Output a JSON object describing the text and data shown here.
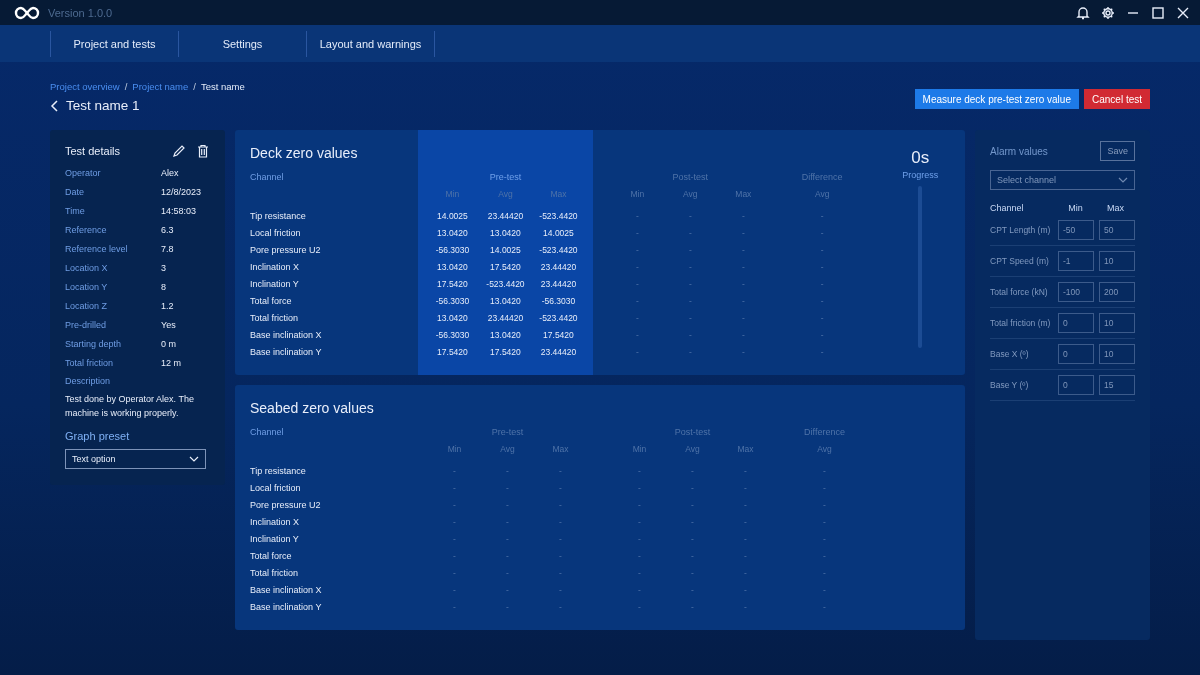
{
  "titlebar": {
    "version": "Version 1.0.0"
  },
  "nav": [
    {
      "label": "Project and tests"
    },
    {
      "label": "Settings"
    },
    {
      "label": "Layout and warnings"
    }
  ],
  "breadcrumb_separator": "/",
  "breadcrumb": [
    {
      "label": "Project overview",
      "link": true
    },
    {
      "label": "Project name",
      "link": true
    },
    {
      "label": "Test name",
      "link": false
    }
  ],
  "page_title": "Test name 1",
  "actions": [
    {
      "label": "Measure deck pre-test zero value",
      "kind": "primary"
    },
    {
      "label": "Cancel test",
      "kind": "danger"
    }
  ],
  "details": {
    "title": "Test details",
    "fields": [
      {
        "label": "Operator",
        "value": "Alex"
      },
      {
        "label": "Date",
        "value": "12/8/2023"
      },
      {
        "label": "Time",
        "value": "14:58:03"
      },
      {
        "label": "Reference",
        "value": "6.3"
      },
      {
        "label": "Reference level",
        "value": "7.8"
      },
      {
        "label": "Location X",
        "value": "3"
      },
      {
        "label": "Location Y",
        "value": "8"
      },
      {
        "label": "Location Z",
        "value": "1.2"
      },
      {
        "label": "Pre-drilled",
        "value": "Yes"
      },
      {
        "label": "Starting depth",
        "value": "0 m"
      },
      {
        "label": "Total friction",
        "value": "12 m"
      }
    ],
    "description_label": "Description",
    "description": "Test done by Operator Alex. The machine is working properly.",
    "preset_label": "Graph preset",
    "preset_value": "Text option"
  },
  "tables": [
    {
      "title": "Deck zero values",
      "channel_header": "Channel",
      "groups": [
        {
          "label": "Pre-test",
          "selected": true,
          "columns": [
            "Min",
            "Avg",
            "Max"
          ]
        },
        {
          "label": "Post-test",
          "selected": false,
          "columns": [
            "Min",
            "Avg",
            "Max"
          ]
        },
        {
          "label": "Difference",
          "selected": false,
          "columns": [
            "Avg"
          ]
        }
      ],
      "progress": {
        "time": "0s",
        "label": "Progress",
        "level": 0
      },
      "rows": [
        {
          "channel": "Tip resistance",
          "values": [
            "14.0025",
            "23.44420",
            "-523.4420",
            "-",
            "-",
            "-",
            "-"
          ]
        },
        {
          "channel": "Local friction",
          "values": [
            "13.0420",
            "13.0420",
            "14.0025",
            "-",
            "-",
            "-",
            "-"
          ]
        },
        {
          "channel": "Pore pressure U2",
          "values": [
            "-56.3030",
            "14.0025",
            "-523.4420",
            "-",
            "-",
            "-",
            "-"
          ]
        },
        {
          "channel": "Inclination X",
          "values": [
            "13.0420",
            "17.5420",
            "23.44420",
            "-",
            "-",
            "-",
            "-"
          ]
        },
        {
          "channel": "Inclination Y",
          "values": [
            "17.5420",
            "-523.4420",
            "23.44420",
            "-",
            "-",
            "-",
            "-"
          ]
        },
        {
          "channel": "Total force",
          "values": [
            "-56.3030",
            "13.0420",
            "-56.3030",
            "-",
            "-",
            "-",
            "-"
          ]
        },
        {
          "channel": "Total friction",
          "values": [
            "13.0420",
            "23.44420",
            "-523.4420",
            "-",
            "-",
            "-",
            "-"
          ]
        },
        {
          "channel": "Base inclination X",
          "values": [
            "-56.3030",
            "13.0420",
            "17.5420",
            "-",
            "-",
            "-",
            "-"
          ]
        },
        {
          "channel": "Base inclination Y",
          "values": [
            "17.5420",
            "17.5420",
            "23.44420",
            "-",
            "-",
            "-",
            "-"
          ]
        }
      ]
    },
    {
      "title": "Seabed zero values",
      "channel_header": "Channel",
      "groups": [
        {
          "label": "Pre-test",
          "selected": false,
          "columns": [
            "Min",
            "Avg",
            "Max"
          ]
        },
        {
          "label": "Post-test",
          "selected": false,
          "columns": [
            "Min",
            "Avg",
            "Max"
          ]
        },
        {
          "label": "Difference",
          "selected": false,
          "columns": [
            "Avg"
          ]
        }
      ],
      "rows": [
        {
          "channel": "Tip resistance",
          "values": [
            "-",
            "-",
            "-",
            "-",
            "-",
            "-",
            "-"
          ]
        },
        {
          "channel": "Local friction",
          "values": [
            "-",
            "-",
            "-",
            "-",
            "-",
            "-",
            "-"
          ]
        },
        {
          "channel": "Pore pressure U2",
          "values": [
            "-",
            "-",
            "-",
            "-",
            "-",
            "-",
            "-"
          ]
        },
        {
          "channel": "Inclination X",
          "values": [
            "-",
            "-",
            "-",
            "-",
            "-",
            "-",
            "-"
          ]
        },
        {
          "channel": "Inclination Y",
          "values": [
            "-",
            "-",
            "-",
            "-",
            "-",
            "-",
            "-"
          ]
        },
        {
          "channel": "Total force",
          "values": [
            "-",
            "-",
            "-",
            "-",
            "-",
            "-",
            "-"
          ]
        },
        {
          "channel": "Total friction",
          "values": [
            "-",
            "-",
            "-",
            "-",
            "-",
            "-",
            "-"
          ]
        },
        {
          "channel": "Base inclination X",
          "values": [
            "-",
            "-",
            "-",
            "-",
            "-",
            "-",
            "-"
          ]
        },
        {
          "channel": "Base inclination Y",
          "values": [
            "-",
            "-",
            "-",
            "-",
            "-",
            "-",
            "-"
          ]
        }
      ]
    }
  ],
  "alarm": {
    "title": "Alarm values",
    "save": "Save",
    "disabled": true,
    "select_placeholder": "Select channel",
    "headers": [
      "Channel",
      "Min",
      "Max"
    ],
    "rows": [
      {
        "channel": "CPT Length (m)",
        "min": "-50",
        "max": "50"
      },
      {
        "channel": "CPT Speed (m)",
        "min": "-1",
        "max": "10"
      },
      {
        "channel": "Total force (kN)",
        "min": "-100",
        "max": "200"
      },
      {
        "channel": "Total friction (m)",
        "min": "0",
        "max": "10"
      },
      {
        "channel": "Base X (º)",
        "min": "0",
        "max": "10"
      },
      {
        "channel": "Base Y (º)",
        "min": "0",
        "max": "15"
      }
    ]
  }
}
